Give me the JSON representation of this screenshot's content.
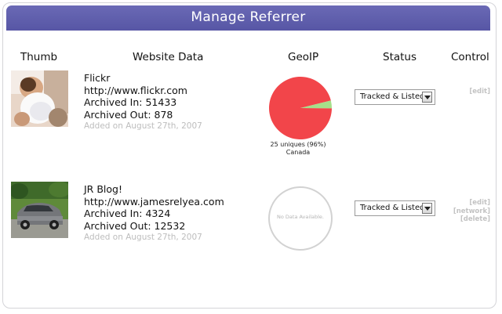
{
  "title": "Manage Referrer",
  "columns": {
    "thumb": "Thumb",
    "website_data": "Website Data",
    "geoip": "GeoIP",
    "status": "Status",
    "control": "Control"
  },
  "rows": [
    {
      "name": "Flickr",
      "url": "http://www.flickr.com",
      "archived_in": "Archived In: 51433",
      "archived_out": "Archived Out: 878",
      "added": "Added on August 27th, 2007",
      "geo_caption_1": "25 uniques (96%)",
      "geo_caption_2": "Canada",
      "geo_share": 0.96,
      "status": "Tracked & Listed",
      "controls": [
        "[edit]"
      ]
    },
    {
      "name": "JR Blog!",
      "url": "http://www.jamesrelyea.com",
      "archived_in": "Archived In: 4324",
      "archived_out": "Archived Out: 12532",
      "added": "Added on August 27th, 2007",
      "geo_empty": "No Data Available.",
      "status": "Tracked & Listed",
      "controls": [
        "[edit]",
        "[network]",
        "[delete]"
      ]
    }
  ],
  "colors": {
    "titlebar": "#5756a5",
    "pie_main": "#f2454a",
    "pie_other": "#a6e08a",
    "muted": "#bdbdbd"
  }
}
